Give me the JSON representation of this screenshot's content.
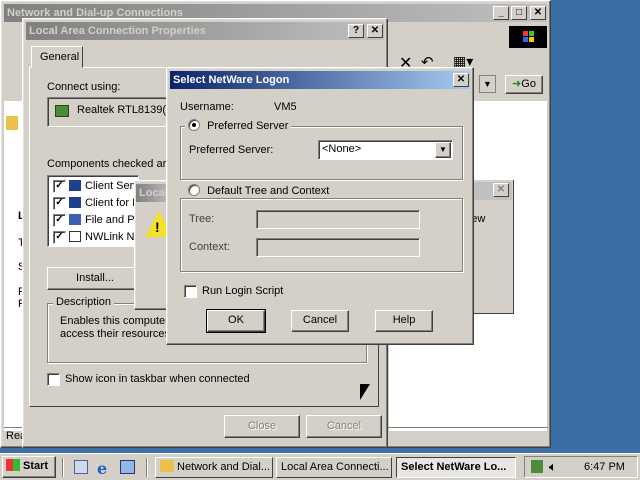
{
  "network_window": {
    "title": "Network and Dial-up Connections",
    "status_text": "Rea",
    "letters": [
      "L",
      "T",
      "S",
      "R",
      "R"
    ],
    "side_text": "e new",
    "toolbar": {
      "go_label": "Go"
    }
  },
  "lac_props": {
    "title": "Local Area Connection Properties",
    "tab_general": "General",
    "connect_using_label": "Connect using:",
    "adapter_name": "Realtek RTL8139(",
    "components_label": "Components checked are",
    "components": [
      "Client Serv",
      "Client for N",
      "File and P",
      "NWLink N"
    ],
    "install_button": "Install...",
    "description_label": "Description",
    "description_text_1": "Enables this computer",
    "description_text_2": "access their resources",
    "show_icon_label": "Show icon in taskbar when connected",
    "close_button": "Close",
    "cancel_button": "Cancel"
  },
  "local_dialog": {
    "title": "Local"
  },
  "netware": {
    "title": "Select NetWare Logon",
    "username_label": "Username:",
    "username_value": "VM5",
    "preferred_server_radio": "Preferred Server",
    "preferred_server_label": "Preferred Server:",
    "preferred_server_value": "<None>",
    "default_tree_radio": "Default Tree and Context",
    "tree_label": "Tree:",
    "context_label": "Context:",
    "run_login_script": "Run Login Script",
    "ok_button": "OK",
    "cancel_button": "Cancel",
    "help_button": "Help"
  },
  "taskbar": {
    "start_label": "Start",
    "tasks": [
      "Network and Dial...",
      "Local Area Connecti...",
      "Select NetWare Lo..."
    ],
    "clock": "6:47 PM"
  }
}
